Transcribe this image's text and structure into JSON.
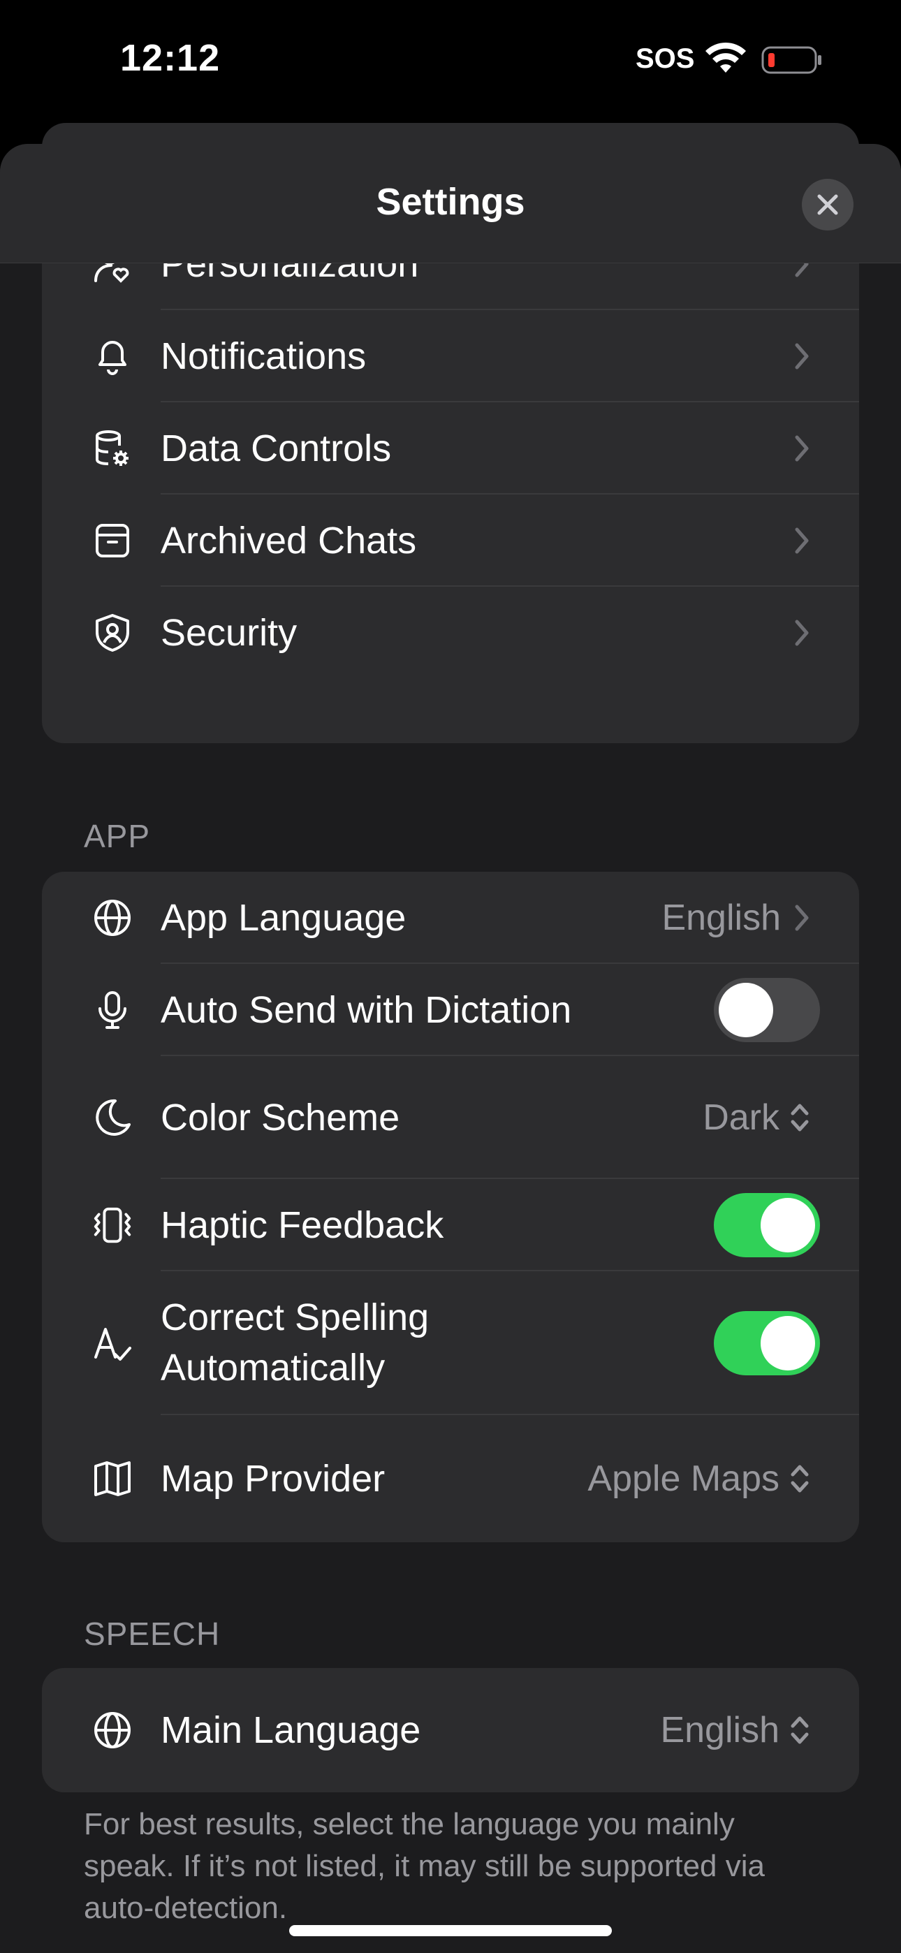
{
  "status": {
    "time": "12:12",
    "carrier": "SOS"
  },
  "header": {
    "title": "Settings",
    "close_icon": "close-icon"
  },
  "account_group": {
    "items": [
      {
        "label": "Personalization",
        "icon": "person-heart-icon"
      },
      {
        "label": "Notifications",
        "icon": "bell-icon"
      },
      {
        "label": "Data Controls",
        "icon": "database-gear-icon"
      },
      {
        "label": "Archived Chats",
        "icon": "archive-box-icon"
      },
      {
        "label": "Security",
        "icon": "shield-person-icon"
      }
    ]
  },
  "app_section": {
    "header": "APP",
    "items": [
      {
        "label": "App Language",
        "value": "English",
        "icon": "globe-icon"
      },
      {
        "label": "Auto Send with Dictation",
        "toggle": false,
        "icon": "microphone-icon"
      },
      {
        "label": "Color Scheme",
        "value": "Dark",
        "icon": "moon-icon"
      },
      {
        "label": "Haptic Feedback",
        "toggle": true,
        "icon": "phone-vibrate-icon"
      },
      {
        "label_line1": "Correct Spelling",
        "label_line2": "Automatically",
        "toggle": true,
        "icon": "spellcheck-icon"
      },
      {
        "label": "Map Provider",
        "value": "Apple Maps",
        "icon": "map-icon"
      }
    ]
  },
  "speech_section": {
    "header": "SPEECH",
    "items": [
      {
        "label": "Main Language",
        "value": "English",
        "icon": "globe-icon"
      }
    ],
    "footnote": "For best results, select the language you mainly speak. If it’s not listed, it may still be supported via auto-detection."
  },
  "colors": {
    "toggle_on": "#30d158",
    "toggle_off": "#48484a",
    "sheet": "#1c1c1e",
    "cell": "#2c2c2e",
    "secondary_text": "#98989d"
  }
}
